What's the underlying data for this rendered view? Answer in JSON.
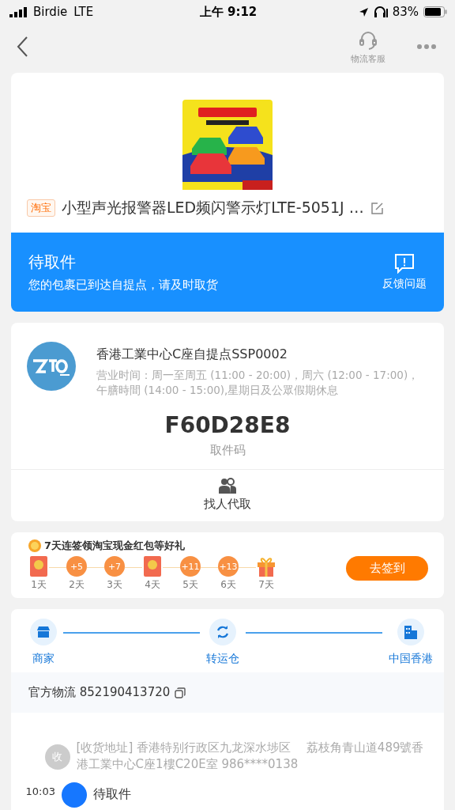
{
  "status_bar": {
    "carrier": "Birdie",
    "network": "LTE",
    "time": "上午 9:12",
    "battery": "83%"
  },
  "nav": {
    "support_label": "物流客服"
  },
  "product": {
    "source_badge": "淘宝",
    "title": "小型声光报警器LED频闪警示灯LTE-5051J …"
  },
  "status_banner": {
    "title": "待取件",
    "subtitle": "您的包裹已到达自提点，请及时取货",
    "action_label": "反馈问题"
  },
  "pickup": {
    "station_name": "香港工業中心C座自提点SSP0002",
    "hours": "营业时间：周一至周五 (11:00 - 20:00)，周六 (12:00 - 17:00)，午膳時間 (14:00 - 15:00),星期日及公眾假期休息",
    "code": "F60D28E8",
    "code_label": "取件码",
    "proxy_label": "找人代取"
  },
  "checkin": {
    "title": "7天连签领淘宝现金红包等好礼",
    "button": "去签到",
    "days": [
      {
        "kind": "red_packet",
        "label": "1天"
      },
      {
        "kind": "points",
        "value": "+5",
        "label": "2天"
      },
      {
        "kind": "points",
        "value": "+7",
        "label": "3天"
      },
      {
        "kind": "red_packet",
        "label": "4天"
      },
      {
        "kind": "points",
        "value": "+11",
        "label": "5天"
      },
      {
        "kind": "points",
        "value": "+13",
        "label": "6天"
      },
      {
        "kind": "gift",
        "label": "7天"
      }
    ]
  },
  "route": {
    "stops": [
      {
        "kind": "shop",
        "label": "商家"
      },
      {
        "kind": "transfer",
        "label": "转运仓"
      },
      {
        "kind": "city",
        "label": "中国香港"
      }
    ]
  },
  "tracking": {
    "label": "官方物流 852190413720"
  },
  "timeline": [
    {
      "kind": "address",
      "badge": "收",
      "text": "[收货地址] 香港特别行政区九龙深水埗区　 荔枝角青山道489號香港工業中心C座1樓C20E室 986****0138"
    },
    {
      "kind": "status",
      "time": "10:03",
      "title": "待取件"
    }
  ]
}
